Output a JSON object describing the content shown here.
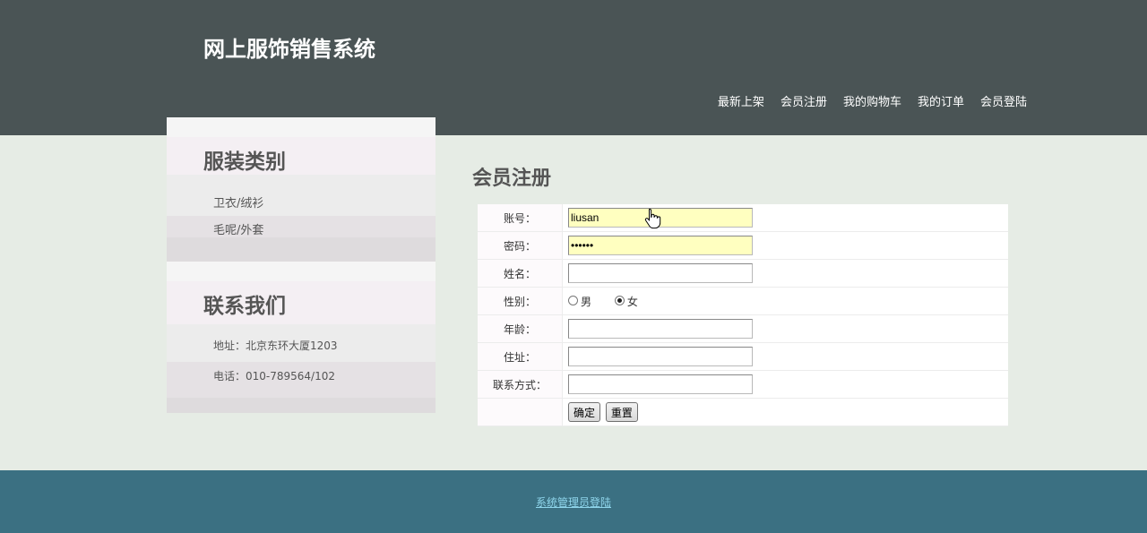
{
  "site": {
    "title": "网上服饰销售系统"
  },
  "nav": {
    "items": [
      "最新上架",
      "会员注册",
      "我的购物车",
      "我的订单",
      "会员登陆"
    ]
  },
  "sidebar": {
    "categories": {
      "heading": "服装类别",
      "items": [
        "卫衣/绒衫",
        "毛呢/外套"
      ]
    },
    "contact": {
      "heading": "联系我们",
      "address": "地址：北京东环大厦1203",
      "phone": "电话：010-789564/102"
    }
  },
  "register": {
    "heading": "会员注册",
    "fields": {
      "account_label": "账号：",
      "account_value": "liusan",
      "password_label": "密码：",
      "password_value": "123456",
      "name_label": "姓名：",
      "gender_label": "性别：",
      "gender_male": "男",
      "gender_female": "女",
      "gender_selected": "女",
      "age_label": "年龄：",
      "address_label": "住址：",
      "contact_label": "联系方式："
    },
    "buttons": {
      "submit": "确定",
      "reset": "重置"
    }
  },
  "footer": {
    "admin_link": "系统管理员登陆"
  },
  "colors": {
    "header_bg": "#4a5455",
    "page_bg": "#e6ece5",
    "footer_bg": "#3b7082",
    "footer_link": "#8fd6ec",
    "input_filled_bg": "#ffffc0"
  },
  "icons": {
    "cursor": "hand-pointer-icon"
  }
}
